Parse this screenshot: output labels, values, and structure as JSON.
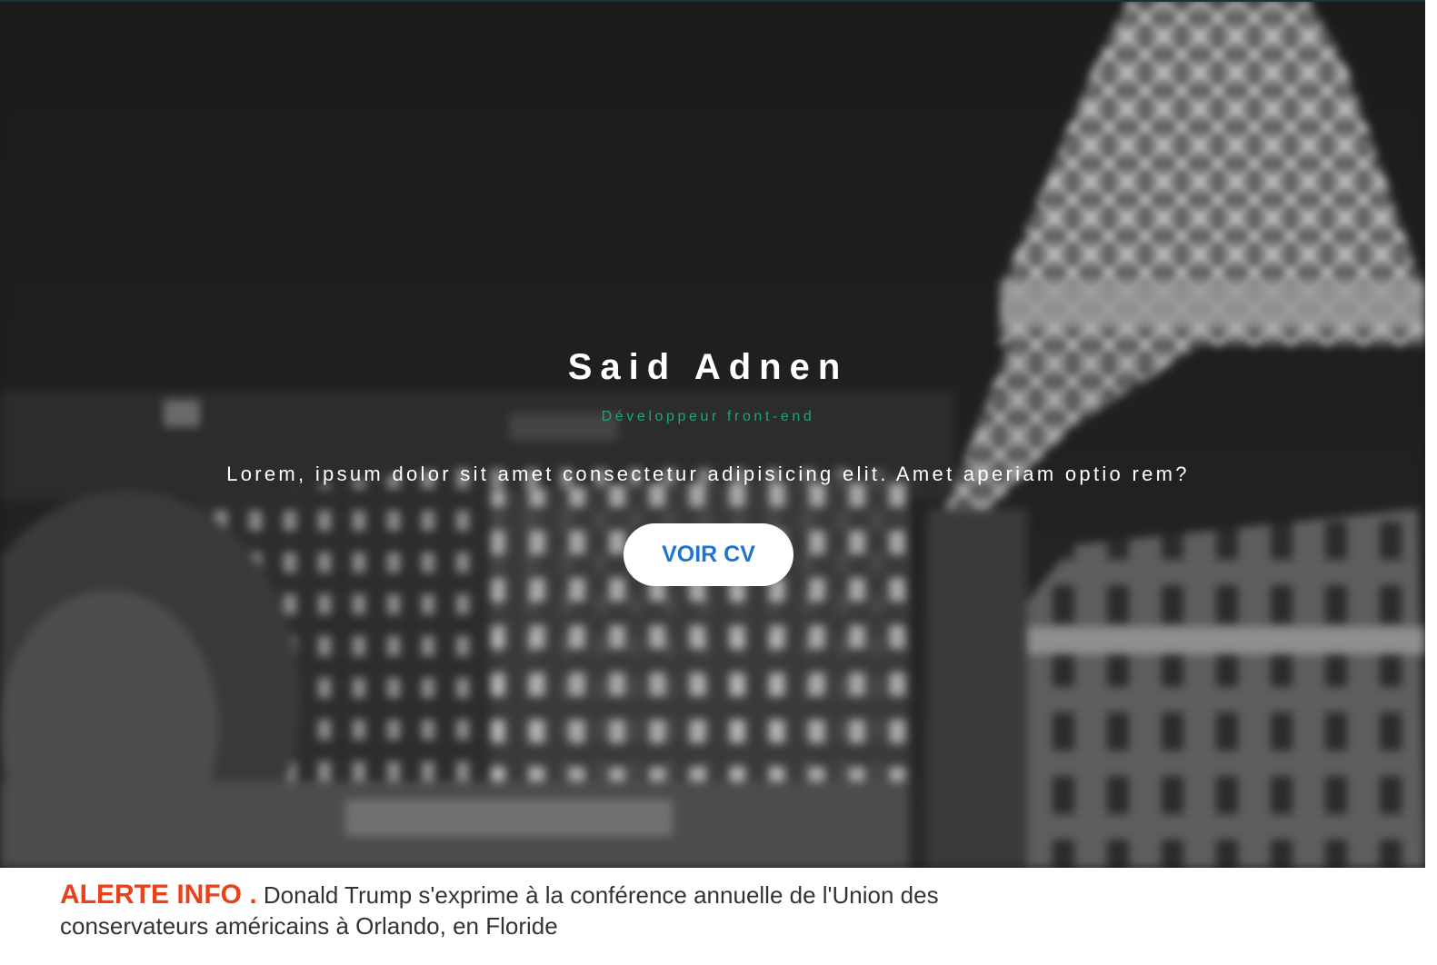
{
  "hero": {
    "name": "Said Adnen",
    "role": "Développeur front-end",
    "tagline": "Lorem, ipsum dolor sit amet consectetur adipisicing elit. Amet aperiam optio rem?",
    "cta_label": "VOIR CV",
    "background_image": "blurred black-and-white Paris night scene with Eiffel Tower"
  },
  "alert": {
    "label": "ALERTE INFO .",
    "text": "Donald Trump s'exprime à la conférence annuelle de l'Union des conservateurs américains à Orlando, en Floride"
  },
  "colors": {
    "subtitle": "#1fa37f",
    "cta_text": "#1f73d2",
    "alert_label": "#e8421a",
    "alert_text": "#333333"
  }
}
